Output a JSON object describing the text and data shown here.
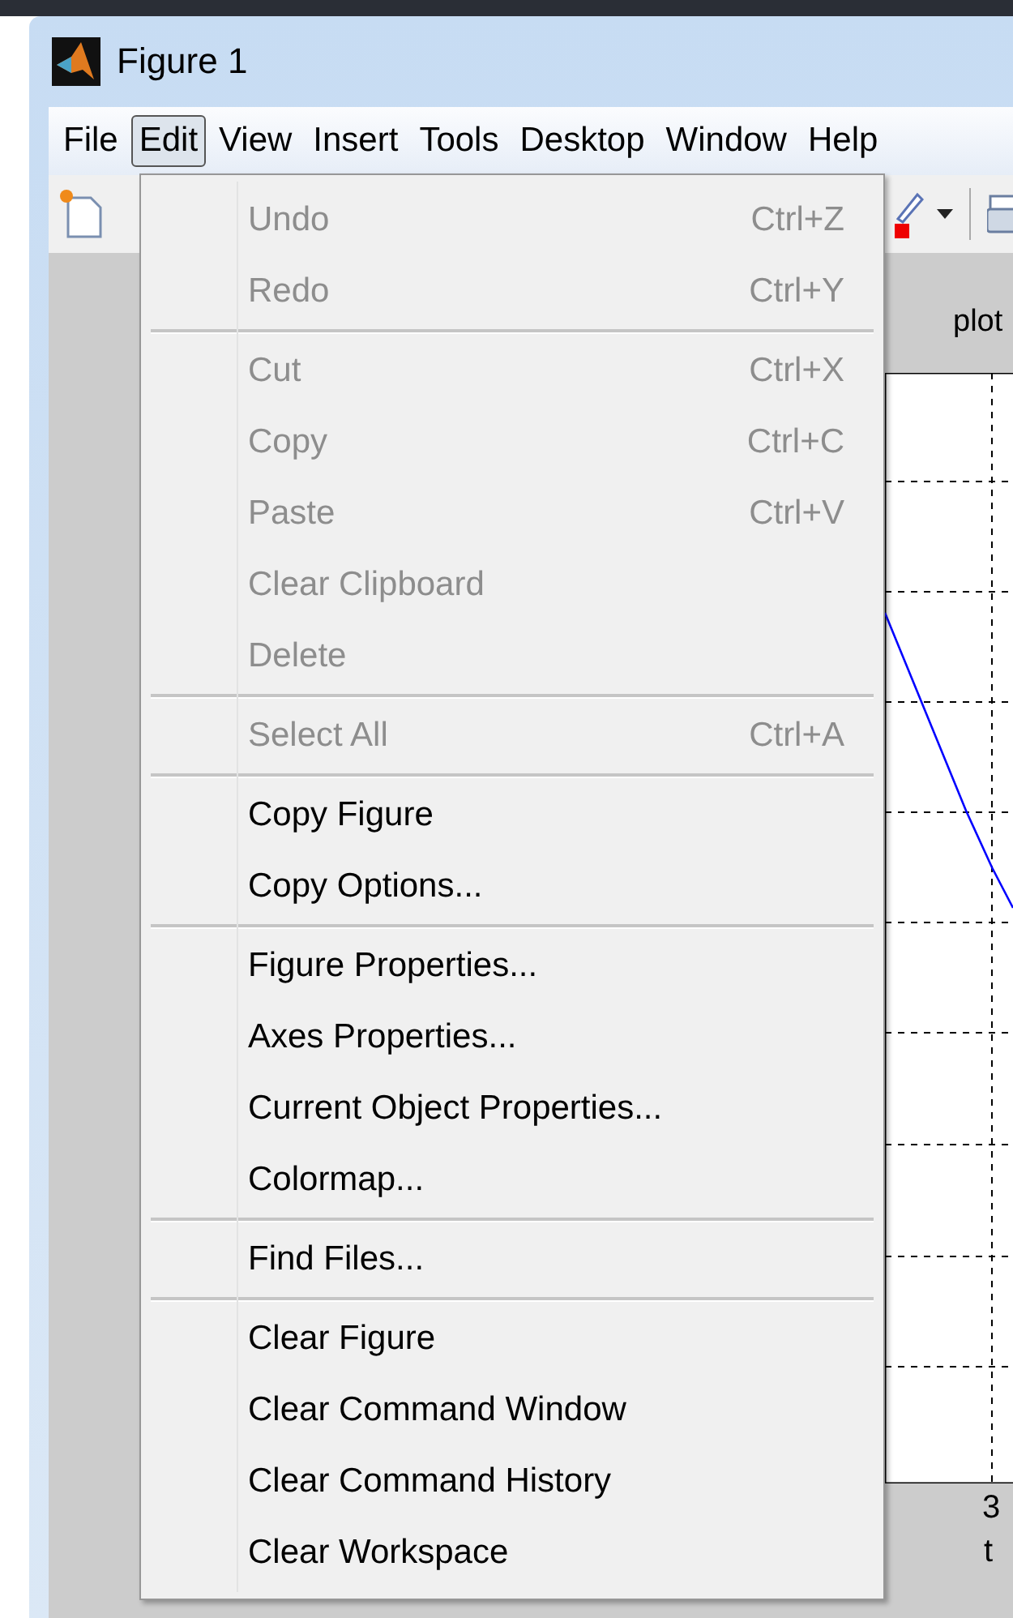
{
  "window": {
    "title": "Figure 1"
  },
  "menubar": [
    {
      "label": "File",
      "selected": false
    },
    {
      "label": "Edit",
      "selected": true
    },
    {
      "label": "View",
      "selected": false
    },
    {
      "label": "Insert",
      "selected": false
    },
    {
      "label": "Tools",
      "selected": false
    },
    {
      "label": "Desktop",
      "selected": false
    },
    {
      "label": "Window",
      "selected": false
    },
    {
      "label": "Help",
      "selected": false
    }
  ],
  "menu": {
    "groups": [
      [
        {
          "label": "Undo",
          "shortcut": "Ctrl+Z",
          "disabled": true
        },
        {
          "label": "Redo",
          "shortcut": "Ctrl+Y",
          "disabled": true
        }
      ],
      [
        {
          "label": "Cut",
          "shortcut": "Ctrl+X",
          "disabled": true
        },
        {
          "label": "Copy",
          "shortcut": "Ctrl+C",
          "disabled": true
        },
        {
          "label": "Paste",
          "shortcut": "Ctrl+V",
          "disabled": true
        },
        {
          "label": "Clear Clipboard",
          "disabled": true
        },
        {
          "label": "Delete",
          "disabled": true
        }
      ],
      [
        {
          "label": "Select All",
          "shortcut": "Ctrl+A",
          "disabled": true
        }
      ],
      [
        {
          "label": "Copy Figure",
          "disabled": false
        },
        {
          "label": "Copy Options...",
          "disabled": false
        }
      ],
      [
        {
          "label": "Figure Properties...",
          "disabled": false
        },
        {
          "label": "Axes Properties...",
          "disabled": false
        },
        {
          "label": "Current Object Properties...",
          "disabled": false
        },
        {
          "label": "Colormap...",
          "disabled": false
        }
      ],
      [
        {
          "label": "Find Files...",
          "disabled": false
        }
      ],
      [
        {
          "label": "Clear Figure",
          "disabled": false
        },
        {
          "label": "Clear Command Window",
          "disabled": false
        },
        {
          "label": "Clear Command History",
          "disabled": false
        },
        {
          "label": "Clear Workspace",
          "disabled": false
        }
      ]
    ]
  },
  "axes": {
    "title": "plot",
    "xtick": "3",
    "xlabel": "t"
  }
}
